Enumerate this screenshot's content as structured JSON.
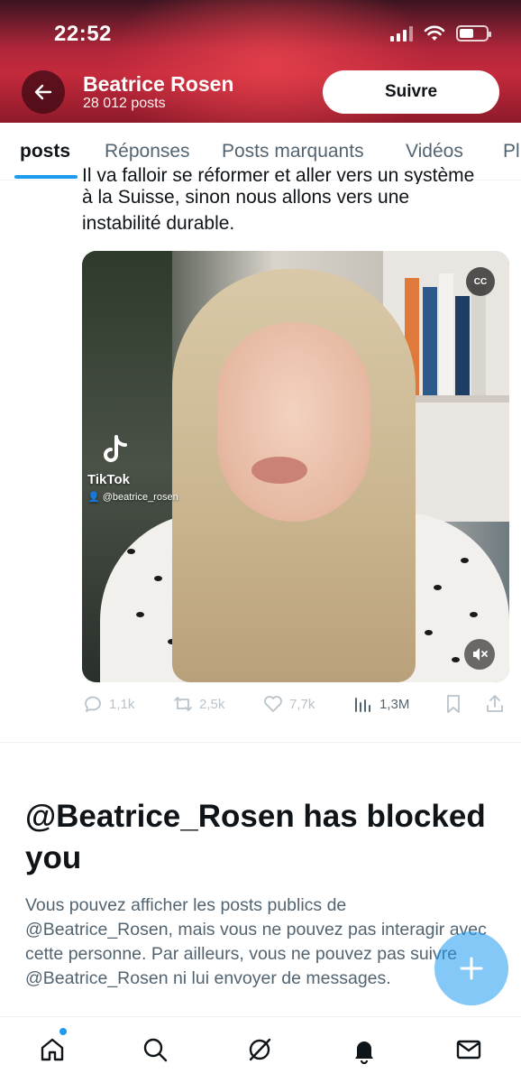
{
  "status_bar": {
    "time": "22:52"
  },
  "header": {
    "name": "Beatrice Rosen",
    "post_count": "28 012 posts",
    "follow_label": "Suivre"
  },
  "tabs": [
    {
      "label": "posts",
      "active": true
    },
    {
      "label": "Réponses"
    },
    {
      "label": "Posts marquants"
    },
    {
      "label": "Vidéos"
    },
    {
      "label": "Pl"
    }
  ],
  "tweet": {
    "text_cut": "Il va falloir se réformer et aller vers un système",
    "text_line2": "à la Suisse, sinon nous allons vers une",
    "text_line3": "instabilité durable.",
    "video": {
      "cc_label": "CC",
      "watermark_name": "TikTok",
      "watermark_handle": "@beatrice_rosen"
    },
    "actions": {
      "replies": "1,1k",
      "reposts": "2,5k",
      "likes": "7,7k",
      "views": "1,3M"
    }
  },
  "blocked": {
    "title": "@Beatrice_Rosen has blocked you",
    "body": "Vous pouvez afficher les posts publics de @Beatrice_Rosen, mais vous ne pouvez pas interagir avec cette personne. Par ailleurs, vous ne pouvez pas suivre @Beatrice_Rosen ni lui envoyer de messages."
  },
  "colors": {
    "accent": "#1d9bf0",
    "banner_red": "#c42a3c",
    "text_primary": "#0f1419",
    "text_secondary": "#536471"
  },
  "icons": {
    "back": "arrow-left-icon",
    "home": "home-icon",
    "search": "search-icon",
    "grok": "grok-icon",
    "notifications": "bell-icon",
    "messages": "envelope-icon",
    "compose": "plus-icon"
  }
}
